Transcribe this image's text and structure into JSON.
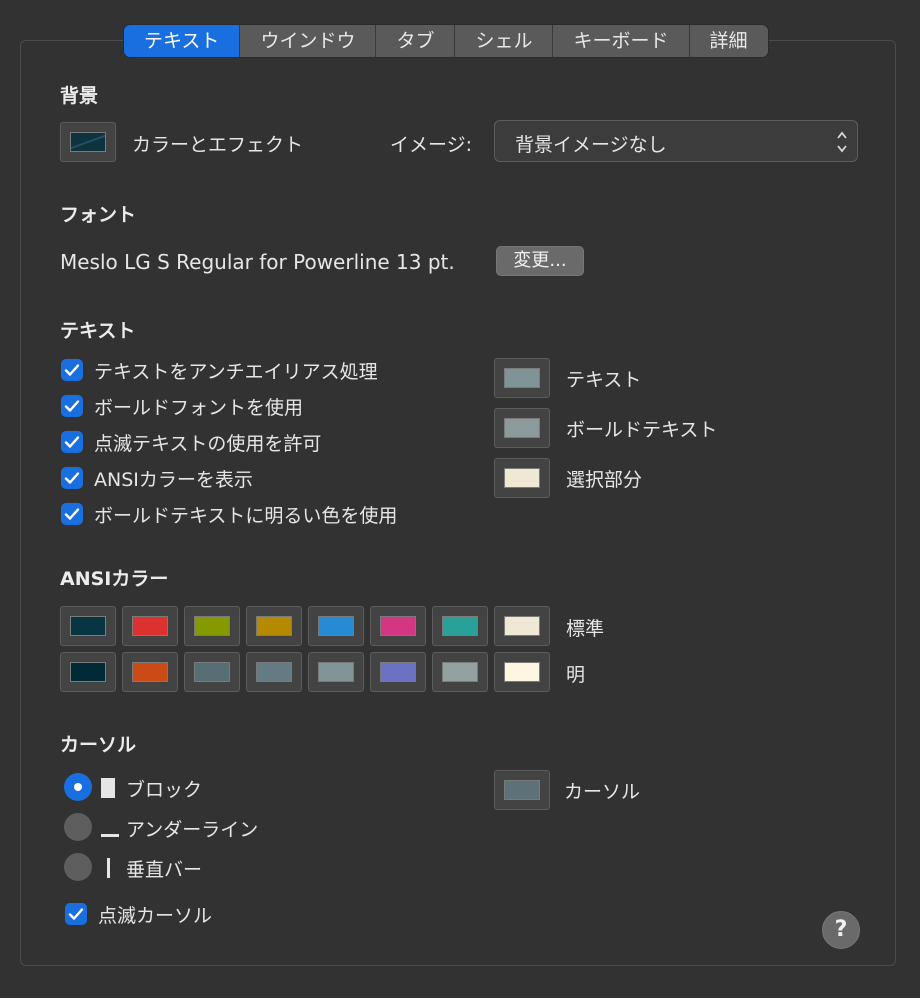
{
  "tabs": [
    {
      "label": "テキスト",
      "active": true
    },
    {
      "label": "ウインドウ",
      "active": false
    },
    {
      "label": "タブ",
      "active": false
    },
    {
      "label": "シェル",
      "active": false
    },
    {
      "label": "キーボード",
      "active": false
    },
    {
      "label": "詳細",
      "active": false
    }
  ],
  "background": {
    "title": "背景",
    "color_effect_label": "カラーとエフェクト",
    "image_label": "イメージ:",
    "image_value": "背景イメージなし"
  },
  "font": {
    "title": "フォント",
    "name": "Meslo LG S Regular for Powerline 13 pt.",
    "change_button": "変更..."
  },
  "text": {
    "title": "テキスト",
    "options": [
      {
        "label": "テキストをアンチエイリアス処理",
        "checked": true
      },
      {
        "label": "ボールドフォントを使用",
        "checked": true
      },
      {
        "label": "点滅テキストの使用を許可",
        "checked": true
      },
      {
        "label": "ANSIカラーを表示",
        "checked": true
      },
      {
        "label": "ボールドテキストに明るい色を使用",
        "checked": true
      }
    ],
    "colors": [
      {
        "label": "テキスト",
        "color": "#7f9396"
      },
      {
        "label": "ボールドテキスト",
        "color": "#8d9a9b"
      },
      {
        "label": "選択部分",
        "color": "#eee8d5"
      }
    ]
  },
  "ansi": {
    "title": "ANSIカラー",
    "normal_label": "標準",
    "bright_label": "明",
    "normal": [
      "#073642",
      "#dc322f",
      "#859900",
      "#b58900",
      "#268bd2",
      "#d33682",
      "#2aa198",
      "#eee8d5"
    ],
    "bright": [
      "#002b36",
      "#cb4b16",
      "#586e75",
      "#657b83",
      "#839496",
      "#6c71c4",
      "#93a1a1",
      "#fdf6e3"
    ]
  },
  "cursor": {
    "title": "カーソル",
    "styles": [
      {
        "label": "ブロック",
        "selected": true
      },
      {
        "label": "アンダーライン",
        "selected": false
      },
      {
        "label": "垂直バー",
        "selected": false
      }
    ],
    "blink_label": "点滅カーソル",
    "blink_checked": true,
    "color_label": "カーソル",
    "color": "#5d7278"
  },
  "help_symbol": "?",
  "colors": {
    "accent": "#1a6fe0",
    "window_bg": "#323232",
    "bg_swatch": "#0d3340"
  }
}
